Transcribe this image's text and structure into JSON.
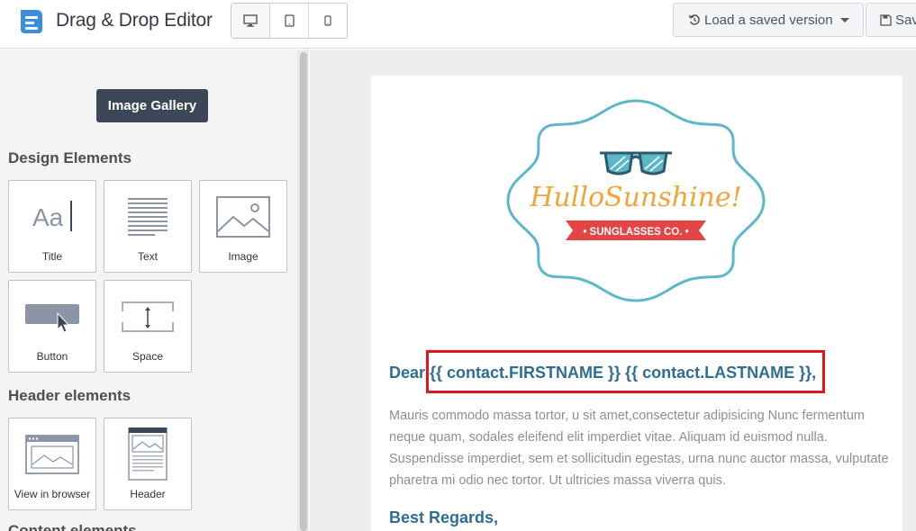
{
  "header": {
    "app_title": "Drag & Drop Editor",
    "device_modes": [
      "desktop-icon",
      "tablet-icon",
      "mobile-icon"
    ],
    "load_saved_label": "Load a saved version",
    "save_label": "Save"
  },
  "sidebar": {
    "gallery_button": "Image Gallery",
    "design_title": "Design Elements",
    "design_items": [
      {
        "label": "Title",
        "icon": "title-icon"
      },
      {
        "label": "Text",
        "icon": "text-icon"
      },
      {
        "label": "Image",
        "icon": "image-icon"
      },
      {
        "label": "Button",
        "icon": "button-icon"
      },
      {
        "label": "Space",
        "icon": "space-icon"
      }
    ],
    "header_title": "Header elements",
    "header_items": [
      {
        "label": "View in browser",
        "icon": "view-in-browser-icon"
      },
      {
        "label": "Header",
        "icon": "header-icon"
      }
    ],
    "content_title": "Content elements"
  },
  "email": {
    "brand_name": "HulloSunshine!",
    "brand_tagline": "• SUNGLASSES CO. •",
    "greeting_prefix": "Dear ",
    "greeting_tokens": "{{ contact.FIRSTNAME }} {{ contact.LASTNAME }},",
    "body": "Mauris commodo massa tortor, u sit amet,consectetur adipisicing Nunc fermentum neque quam, sodales eleifend elit imperdiet vitae. Aliquam id euismod nulla. Suspendisse imperdiet, sem et sollicitudin egestas, urna nunc auctor massa, vulputate pharetra mi odio nec tortor. Ut ultricies massa viverra quis.",
    "closing": "Best Regards,"
  },
  "colors": {
    "accent_dark": "#3b4656",
    "link_blue": "#2f6e92",
    "highlight_red": "#e3141b",
    "logo_teal": "#5cb8c9",
    "logo_orange": "#f0a43a"
  }
}
